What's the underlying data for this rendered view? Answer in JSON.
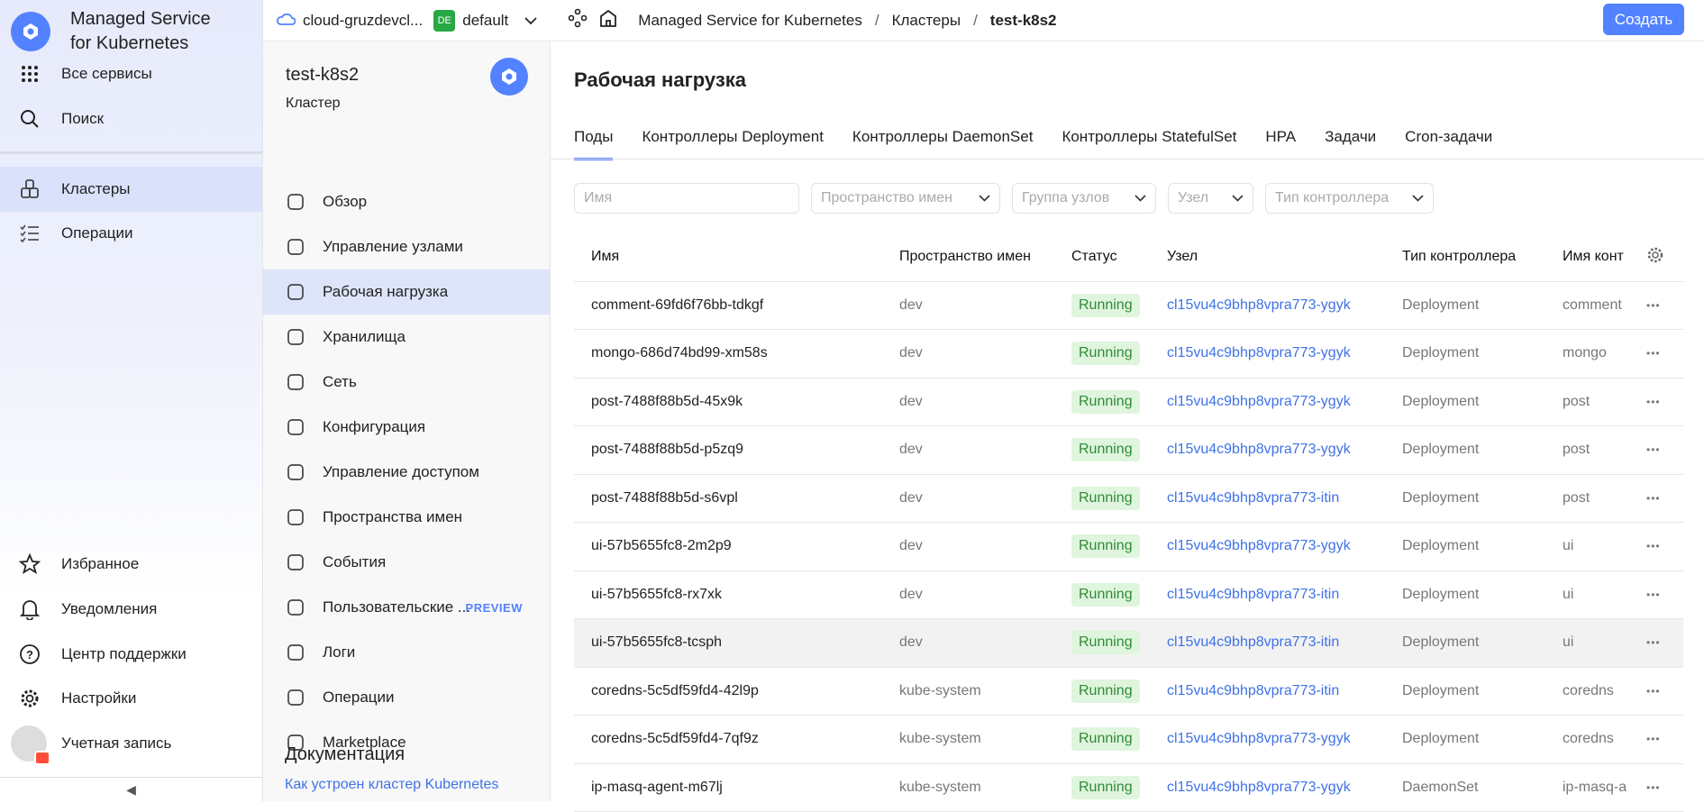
{
  "nav": {
    "brand": [
      "Managed Service",
      "for Kubernetes"
    ],
    "top_items": [
      {
        "label": "Все сервисы",
        "icon": "grid-icon"
      },
      {
        "label": "Поиск",
        "icon": "search-icon"
      },
      {
        "label": "Кластеры",
        "icon": "clusters-icon",
        "active": true
      },
      {
        "label": "Операции",
        "icon": "operations-icon"
      }
    ],
    "bottom_items": [
      {
        "label": "Избранное",
        "icon": "star-icon"
      },
      {
        "label": "Уведомления",
        "icon": "bell-icon"
      },
      {
        "label": "Центр поддержки",
        "icon": "help-icon"
      },
      {
        "label": "Настройки",
        "icon": "gear-icon"
      },
      {
        "label": "Учетная запись",
        "icon": "avatar-icon"
      }
    ],
    "collapse": "◀"
  },
  "header": {
    "cloud": "cloud-gruzdevcl...",
    "folder_badge": "DE",
    "folder": "default",
    "breadcrumbs": [
      "Managed Service for Kubernetes",
      "Кластеры",
      "test-k8s2"
    ],
    "separator": "/",
    "create_label": "Создать"
  },
  "sidebar": {
    "title": "test-k8s2",
    "subtitle": "Кластер",
    "items": [
      {
        "label": "Обзор"
      },
      {
        "label": "Управление узлами"
      },
      {
        "label": "Рабочая нагрузка",
        "active": true
      },
      {
        "label": "Хранилища"
      },
      {
        "label": "Сеть"
      },
      {
        "label": "Конфигурация"
      },
      {
        "label": "Управление доступом"
      },
      {
        "label": "Пространства имен"
      },
      {
        "label": "События"
      },
      {
        "label": "Пользовательские ...",
        "badge": "PREVIEW"
      },
      {
        "label": "Логи"
      },
      {
        "label": "Операции"
      },
      {
        "label": "Marketplace"
      }
    ],
    "docs_title": "Документация",
    "docs_link": "Как устроен кластер Kubernetes"
  },
  "main": {
    "title": "Рабочая нагрузка",
    "tabs": [
      "Поды",
      "Контроллеры Deployment",
      "Контроллеры DaemonSet",
      "Контроллеры StatefulSet",
      "HPA",
      "Задачи",
      "Cron-задачи"
    ],
    "active_tab": "Поды",
    "filters": {
      "name_placeholder": "Имя",
      "namespace": "Пространство имен",
      "node_group": "Группа узлов",
      "node": "Узел",
      "controller_type": "Тип контроллера"
    },
    "columns": [
      "Имя",
      "Пространство имен",
      "Статус",
      "Узел",
      "Тип контроллера",
      "Имя конт"
    ],
    "rows": [
      [
        "comment-69fd6f76bb-tdkgf",
        "dev",
        "Running",
        "cl15vu4c9bhp8vpra773-ygyk",
        "Deployment",
        "comment"
      ],
      [
        "mongo-686d74bd99-xm58s",
        "dev",
        "Running",
        "cl15vu4c9bhp8vpra773-ygyk",
        "Deployment",
        "mongo"
      ],
      [
        "post-7488f88b5d-45x9k",
        "dev",
        "Running",
        "cl15vu4c9bhp8vpra773-ygyk",
        "Deployment",
        "post"
      ],
      [
        "post-7488f88b5d-p5zq9",
        "dev",
        "Running",
        "cl15vu4c9bhp8vpra773-ygyk",
        "Deployment",
        "post"
      ],
      [
        "post-7488f88b5d-s6vpl",
        "dev",
        "Running",
        "cl15vu4c9bhp8vpra773-itin",
        "Deployment",
        "post"
      ],
      [
        "ui-57b5655fc8-2m2p9",
        "dev",
        "Running",
        "cl15vu4c9bhp8vpra773-ygyk",
        "Deployment",
        "ui"
      ],
      [
        "ui-57b5655fc8-rx7xk",
        "dev",
        "Running",
        "cl15vu4c9bhp8vpra773-itin",
        "Deployment",
        "ui"
      ],
      [
        "ui-57b5655fc8-tcsph",
        "dev",
        "Running",
        "cl15vu4c9bhp8vpra773-itin",
        "Deployment",
        "ui"
      ],
      [
        "coredns-5c5df59fd4-42l9p",
        "kube-system",
        "Running",
        "cl15vu4c9bhp8vpra773-itin",
        "Deployment",
        "coredns"
      ],
      [
        "coredns-5c5df59fd4-7qf9z",
        "kube-system",
        "Running",
        "cl15vu4c9bhp8vpra773-ygyk",
        "Deployment",
        "coredns"
      ],
      [
        "ip-masq-agent-m67lj",
        "kube-system",
        "Running",
        "cl15vu4c9bhp8vpra773-ygyk",
        "DaemonSet",
        "ip-masq-a"
      ]
    ],
    "hovered_row": 7,
    "row_menu": "•••",
    "colors": {
      "accent": "#5282ff",
      "running_bg": "#dff5dd",
      "running_text": "#2e8c35",
      "link": "#3f72e6"
    }
  }
}
